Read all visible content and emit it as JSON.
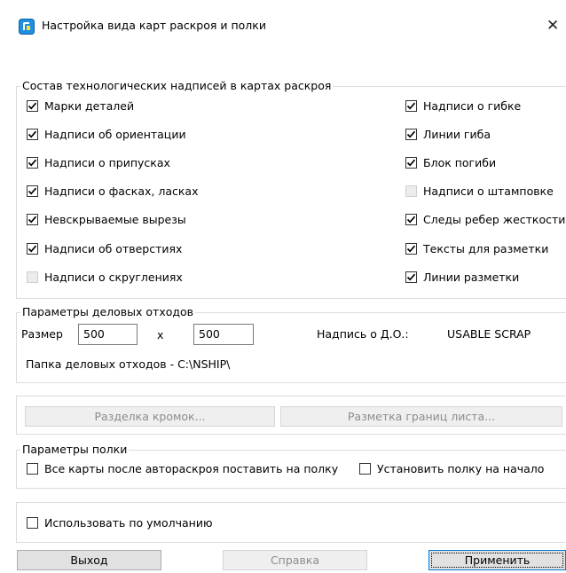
{
  "window": {
    "title": "Настройка вида карт раскроя и полки",
    "close": "✕"
  },
  "labels_group": {
    "legend": "Состав технологических надписей в картах раскроя",
    "left": [
      {
        "label": "Марки деталей",
        "checked": true,
        "enabled": true
      },
      {
        "label": "Надписи об ориентации",
        "checked": true,
        "enabled": true
      },
      {
        "label": "Надписи о припусках",
        "checked": true,
        "enabled": true
      },
      {
        "label": "Надписи о фасках, ласках",
        "checked": true,
        "enabled": true
      },
      {
        "label": "Невскрываемые вырезы",
        "checked": true,
        "enabled": true
      },
      {
        "label": "Надписи об отверстиях",
        "checked": true,
        "enabled": true
      },
      {
        "label": "Надписи о скруглениях",
        "checked": false,
        "enabled": false
      }
    ],
    "right": [
      {
        "label": "Надписи о гибке",
        "checked": true,
        "enabled": true
      },
      {
        "label": "Линии гиба",
        "checked": true,
        "enabled": true
      },
      {
        "label": "Блок погиби",
        "checked": true,
        "enabled": true
      },
      {
        "label": "Надписи о штамповке",
        "checked": false,
        "enabled": false
      },
      {
        "label": "Следы ребер жесткости",
        "checked": true,
        "enabled": true
      },
      {
        "label": "Тексты для разметки",
        "checked": true,
        "enabled": true
      },
      {
        "label": "Линии разметки",
        "checked": true,
        "enabled": true
      }
    ]
  },
  "scrap_group": {
    "legend": "Параметры деловых отходов",
    "size_label": "Размер",
    "width_value": "500",
    "x_label": "x",
    "height_value": "500",
    "inscription_label": "Надпись о Д.О.:",
    "inscription_value": "USABLE SCRAP",
    "folder_text": "Папка деловых отходов - C:\\NSHIP\\"
  },
  "buttons_group": {
    "edge_prep": "Разделка кромок...",
    "sheet_bounds": "Разметка границ листа..."
  },
  "shelf_group": {
    "legend": "Параметры полки",
    "all_to_shelf": "Все карты после автораскроя поставить на полку",
    "shelf_to_start": "Установить полку на начало"
  },
  "default_group": {
    "use_default": "Использовать по умолчанию"
  },
  "footer": {
    "exit": "Выход",
    "help": "Справка",
    "apply": "Применить"
  }
}
